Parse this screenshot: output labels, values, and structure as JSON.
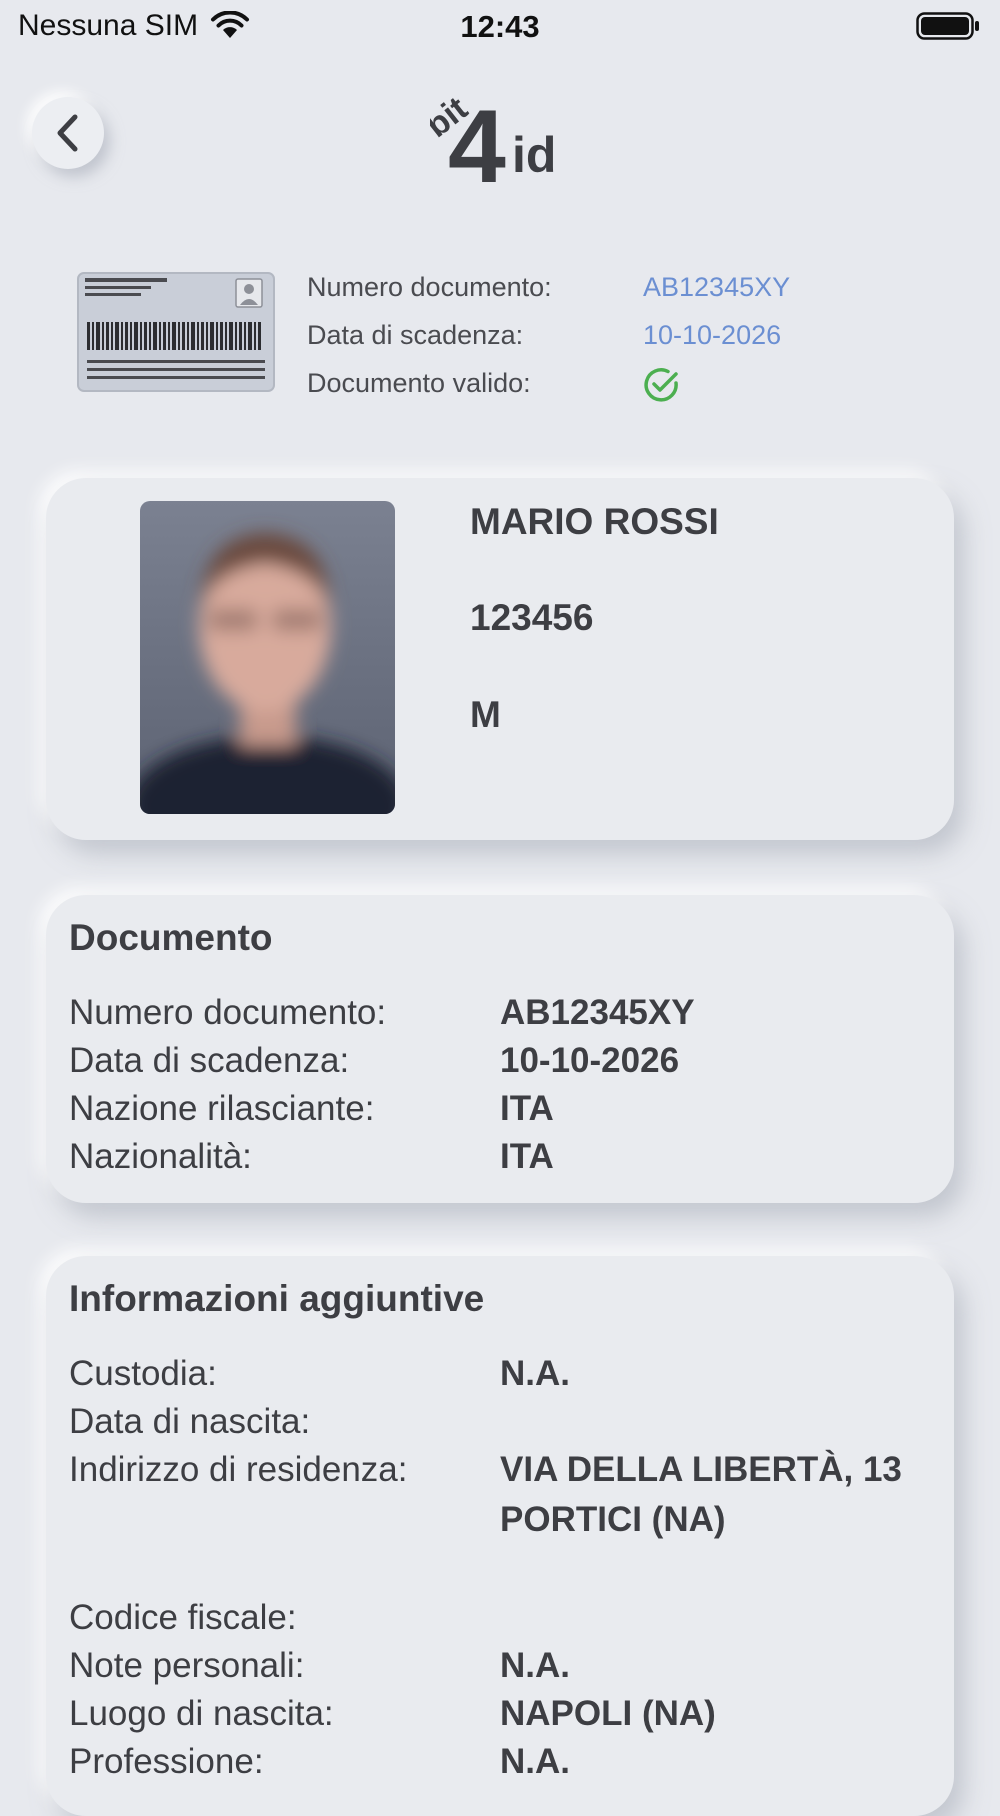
{
  "status_bar": {
    "carrier": "Nessuna SIM",
    "time": "12:43"
  },
  "header": {
    "logo_text_small": "bit",
    "logo_text_number": "4",
    "logo_text_id": "id"
  },
  "summary": {
    "rows": [
      {
        "label": "Numero documento:",
        "value": "AB12345XY"
      },
      {
        "label": "Data di scadenza:",
        "value": "10-10-2026"
      },
      {
        "label": "Documento valido:",
        "value": ""
      }
    ],
    "accent_color": "#6b8fd2",
    "valid_color": "#4caf50"
  },
  "profile": {
    "name": "MARIO ROSSI",
    "id_number": "123456",
    "gender": "M"
  },
  "documento": {
    "title": "Documento",
    "rows": [
      {
        "label": "Numero documento:",
        "value": "AB12345XY"
      },
      {
        "label": "Data di scadenza:",
        "value": "10-10-2026"
      },
      {
        "label": "Nazione rilasciante:",
        "value": "ITA"
      },
      {
        "label": "Nazionalità:",
        "value": "ITA"
      }
    ]
  },
  "info": {
    "title": "Informazioni aggiuntive",
    "rows": [
      {
        "label": "Custodia:",
        "value": "N.A."
      },
      {
        "label": "Data di nascita:",
        "value": ""
      },
      {
        "label": "Indirizzo di residenza:",
        "value": "VIA DELLA LIBERTÀ, 13",
        "value2": "PORTICI (NA)"
      },
      {
        "label": "Codice fiscale:",
        "value": ""
      },
      {
        "label": "Note personali:",
        "value": "N.A."
      },
      {
        "label": "Luogo di nascita:",
        "value": "NAPOLI (NA)"
      },
      {
        "label": "Professione:",
        "value": "N.A."
      }
    ]
  }
}
